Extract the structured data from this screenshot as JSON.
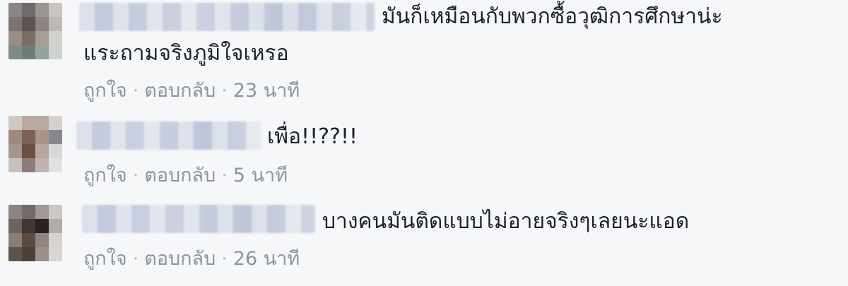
{
  "colors": {
    "background": "#f6f7f9",
    "text": "#1d2129",
    "meta": "#8d949e"
  },
  "comments": [
    {
      "text": "มันก็เหมือนกับพวกซื้อวุฒิการศึกษาน่ะ แระถามจริงภูมิใจเหรอ",
      "line1": "มันก็เหมือนกับพวกซื้อวุฒิการศึกษาน่ะ",
      "line2": "แระถามจริงภูมิใจเหรอ",
      "like": "ถูกใจ",
      "reply": "ตอบกลับ",
      "time": "23 นาที"
    },
    {
      "text": "เพื่อ!!??!!",
      "like": "ถูกใจ",
      "reply": "ตอบกลับ",
      "time": "5 นาที"
    },
    {
      "text": "บางคนมันติดแบบไม่อายจริงๆเลยนะแอด",
      "like": "ถูกใจ",
      "reply": "ตอบกลับ",
      "time": "26 นาที"
    }
  ],
  "separator": "·"
}
